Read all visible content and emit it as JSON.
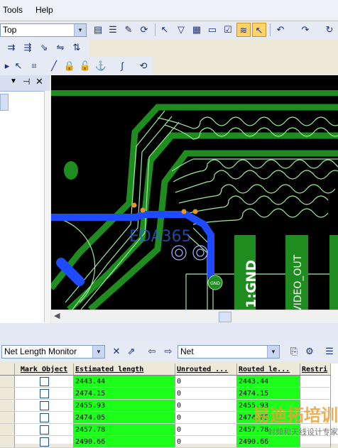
{
  "menu": {
    "tools": "Tools",
    "help": "Help"
  },
  "toolbar": {
    "layer_value": "Top",
    "active_color": "#FFD36A"
  },
  "icons": [
    "properties-icon",
    "list-icon",
    "highlight-icon",
    "refresh-icon",
    "route-icon",
    "drc-icon",
    "clear-icon",
    "save-icon",
    "check-icon",
    "netlength-icon",
    "select-icon",
    "undo-icon",
    "redo-icon",
    "more-icon"
  ],
  "pcb": {
    "labels": {
      "logo": "EDA365",
      "gnd_pad": "GND",
      "pin_gnd": "1:GND",
      "pin_video": "VIDEO_OUT"
    },
    "colors": {
      "background": "#000000",
      "copper": "#1E8C1E",
      "trace_blue": "#1E4BFF",
      "silk": "#9EEA9E",
      "pad_orange": "#E8962C",
      "pad_outline": "#B0B0FF"
    }
  },
  "bottom": {
    "monitor_select": "Net Length Monitor",
    "net_filter": "Net",
    "columns": [
      "Mark Object",
      "Estimated length",
      "Unrouted ...",
      "Routed le...",
      "Restri"
    ],
    "rows": [
      {
        "estimated": "2443.44",
        "unrouted": "0",
        "routed": "2443.44"
      },
      {
        "estimated": "2474.15",
        "unrouted": "0",
        "routed": "2474.15"
      },
      {
        "estimated": "2455.93",
        "unrouted": "0",
        "routed": "2455.93"
      },
      {
        "estimated": "2474.05",
        "unrouted": "0",
        "routed": "2474.05"
      },
      {
        "estimated": "2457.78",
        "unrouted": "0",
        "routed": "2457.78"
      },
      {
        "estimated": "2490.66",
        "unrouted": "0",
        "routed": "2490.66"
      }
    ]
  },
  "watermark": {
    "line1": "易迪拓培训",
    "line2": "射频和天线设计专家"
  }
}
